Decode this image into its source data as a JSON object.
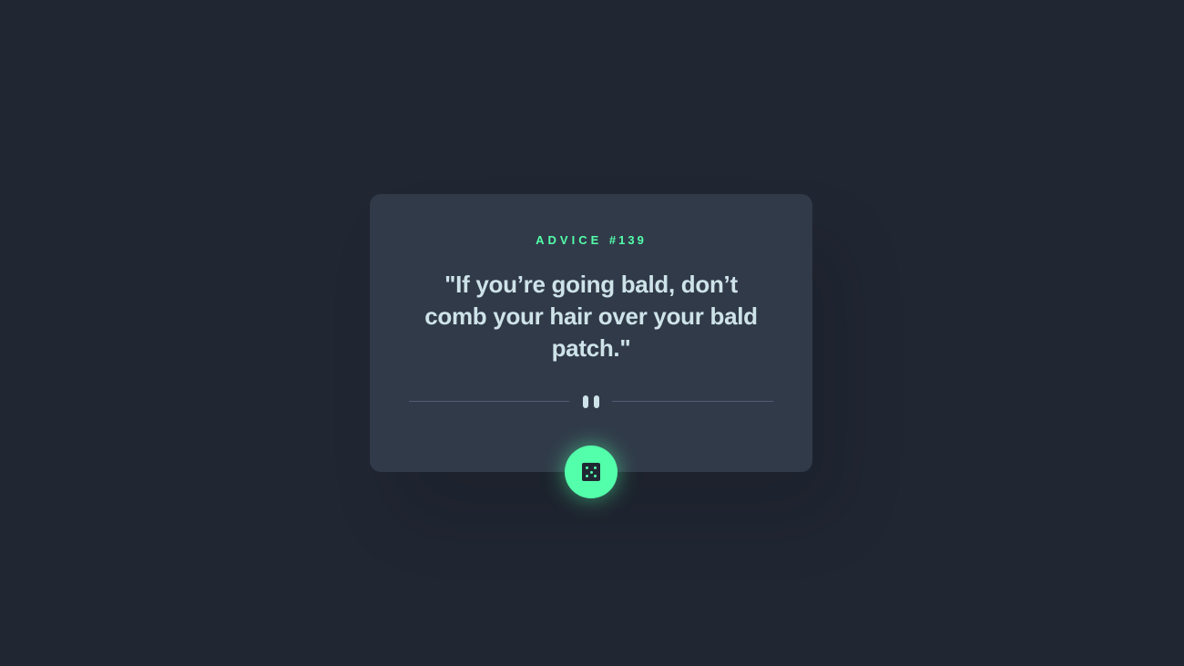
{
  "advice": {
    "label": "ADVICE",
    "number": "#139",
    "quote": "\"If you’re going bald, don’t comb your hair over your bald patch.\""
  },
  "icons": {
    "divider": "pause-icon",
    "button": "dice-icon"
  },
  "colors": {
    "background": "#202632",
    "card": "#313a49",
    "accent": "#53ffaa",
    "text": "#cee3e9",
    "divider": "#4f5d74"
  }
}
